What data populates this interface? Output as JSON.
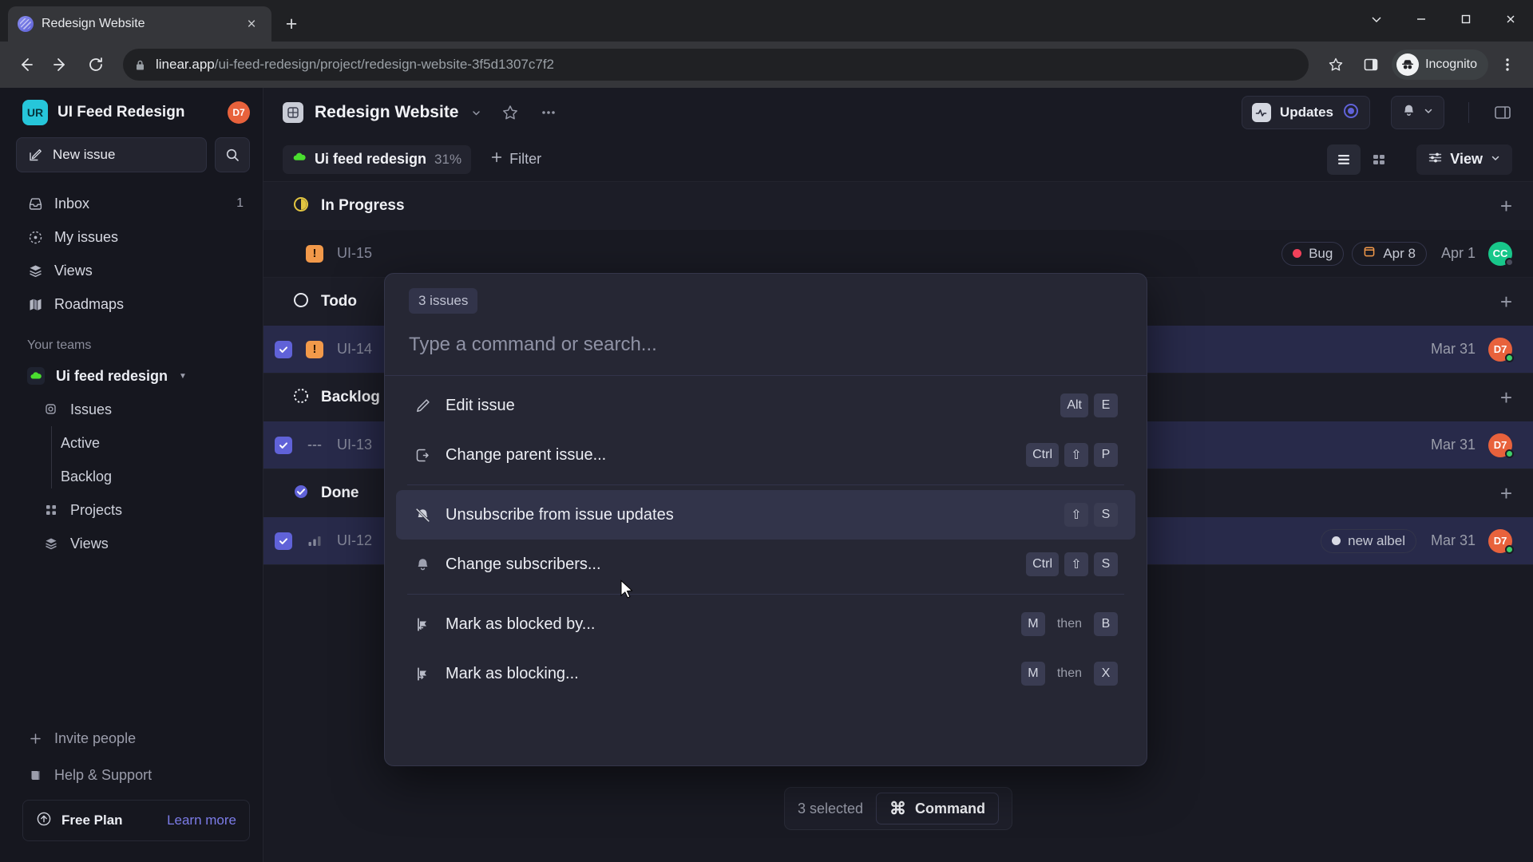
{
  "browser": {
    "tab_title": "Redesign Website",
    "url_host": "linear.app",
    "url_path": "/ui-feed-redesign/project/redesign-website-3f5d1307c7f2",
    "profile_label": "Incognito",
    "new_tab_label": "+",
    "close_tab_label": "×"
  },
  "sidebar": {
    "workspace": {
      "initials": "UR",
      "name": "UI Feed Redesign",
      "user_initials": "D7"
    },
    "new_issue_label": "New issue",
    "nav": [
      {
        "label": "Inbox",
        "icon": "inbox-icon",
        "badge": "1"
      },
      {
        "label": "My issues",
        "icon": "my-issues-icon",
        "badge": ""
      },
      {
        "label": "Views",
        "icon": "views-icon",
        "badge": ""
      },
      {
        "label": "Roadmaps",
        "icon": "roadmaps-icon",
        "badge": ""
      }
    ],
    "teams_label": "Your teams",
    "team": {
      "name": "Ui feed redesign"
    },
    "team_items": [
      {
        "label": "Issues",
        "icon": "issues-icon"
      },
      {
        "label": "Projects",
        "icon": "projects-icon"
      },
      {
        "label": "Views",
        "icon": "views-icon"
      }
    ],
    "issue_children": [
      {
        "label": "Active"
      },
      {
        "label": "Backlog"
      }
    ],
    "footer": [
      {
        "label": "Invite people",
        "icon": "plus-icon"
      },
      {
        "label": "Help & Support",
        "icon": "book-icon"
      }
    ],
    "plan": {
      "name": "Free Plan",
      "link": "Learn more"
    }
  },
  "header": {
    "project_title": "Redesign Website",
    "updates_label": "Updates",
    "icons": {
      "star": "star-icon",
      "more": "more-icon",
      "bell": "bell-icon",
      "panel": "panel-toggle-icon"
    }
  },
  "filterbar": {
    "project_pill_name": "Ui feed redesign",
    "project_pill_percent": "31%",
    "filter_label": "Filter",
    "view_label": "View"
  },
  "issues": {
    "groups": [
      {
        "name": "In Progress",
        "status": "in-progress"
      },
      {
        "name": "Todo",
        "status": "todo"
      },
      {
        "name": "Backlog",
        "status": "backlog"
      },
      {
        "name": "Done",
        "status": "done"
      }
    ],
    "rows": [
      {
        "id": "UI-15",
        "selected": false,
        "priority": "urgent",
        "label": "Bug",
        "label_color": "#f2415a",
        "date_chip": "Apr 8",
        "date": "Apr 1",
        "avatar_initials": "CC",
        "avatar_color": "#18c78a"
      },
      {
        "id": "UI-14",
        "selected": true,
        "priority": "urgent",
        "label": "",
        "label_color": "",
        "date_chip": "",
        "date": "Mar 31",
        "avatar_initials": "D7",
        "avatar_color": "#e8623c"
      },
      {
        "id": "UI-13",
        "selected": true,
        "priority": "none",
        "label": "",
        "label_color": "",
        "date_chip": "",
        "date": "Mar 31",
        "avatar_initials": "D7",
        "avatar_color": "#e8623c"
      },
      {
        "id": "UI-12",
        "selected": true,
        "priority": "medium",
        "label": "new albel",
        "label_color": "#d8dae4",
        "date_chip": "",
        "date": "Mar 31",
        "avatar_initials": "D7",
        "avatar_color": "#e8623c"
      }
    ]
  },
  "selection_bar": {
    "count_label": "3 selected",
    "command_label": "Command",
    "command_glyph": "⌘"
  },
  "palette": {
    "issues_chip": "3 issues",
    "placeholder": "Type a command or search...",
    "items": [
      {
        "label": "Edit issue",
        "icon": "pencil-icon",
        "keys": [
          "Alt",
          "E"
        ],
        "active": false,
        "sep_after": false
      },
      {
        "label": "Change parent issue...",
        "icon": "parent-issue-icon",
        "keys": [
          "Ctrl",
          "⇧",
          "P"
        ],
        "active": false,
        "sep_after": true
      },
      {
        "label": "Unsubscribe from issue updates",
        "icon": "unsubscribe-icon",
        "keys": [
          "⇧",
          "S"
        ],
        "active": true,
        "sep_after": false
      },
      {
        "label": "Change subscribers...",
        "icon": "bell-icon",
        "keys": [
          "Ctrl",
          "⇧",
          "S"
        ],
        "active": false,
        "sep_after": true
      },
      {
        "label": "Mark as blocked by...",
        "icon": "blocked-by-icon",
        "keys": [
          "M",
          "then",
          "B"
        ],
        "active": false,
        "sep_after": false
      },
      {
        "label": "Mark as blocking...",
        "icon": "blocking-icon",
        "keys": [
          "M",
          "then",
          "X"
        ],
        "active": false,
        "sep_after": false
      }
    ]
  },
  "colors": {
    "accent": "#6062d8",
    "selected_row": "#282a4a",
    "urgent": "#f2994a",
    "link": "#7c7ce8"
  }
}
